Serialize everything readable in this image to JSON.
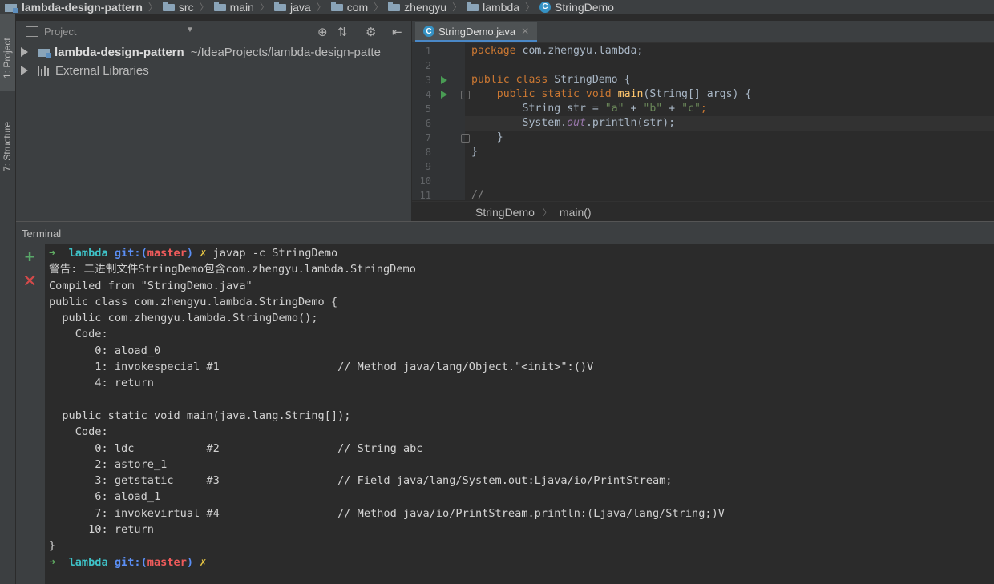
{
  "breadcrumb": [
    "lambda-design-pattern",
    "src",
    "main",
    "java",
    "com",
    "zhengyu",
    "lambda",
    "StringDemo"
  ],
  "class_icon_letter": "C",
  "sidebar": {
    "project_tab": "1: Project",
    "structure_tab": "7: Structure"
  },
  "project_panel": {
    "title": "Project",
    "tree": [
      {
        "name": "lambda-design-pattern",
        "path": "~/IdeaProjects/lambda-design-patte"
      },
      {
        "name": "External Libraries"
      }
    ]
  },
  "editor": {
    "tab": "StringDemo.java",
    "line_numbers": [
      "1",
      "2",
      "3",
      "4",
      "5",
      "6",
      "7",
      "8",
      "9",
      "10",
      "11"
    ],
    "code": {
      "l1_kw": "package",
      "l1_rest": " com.zhengyu.lambda;",
      "l3_kw": "public class",
      "l3_rest": " StringDemo {",
      "l4_kw": "public static void",
      "l4_fn": "main",
      "l4_rest": "(String[] args) {",
      "l5_a": "String str = ",
      "l5_s1": "\"a\"",
      "l5_p1": " + ",
      "l5_s2": "\"b\"",
      "l5_p2": " + ",
      "l5_s3": "\"c\"",
      "l5_end": ";",
      "l6_a": "System.",
      "l6_it": "out",
      "l6_b": ".println(str);",
      "l7": "}",
      "l8": "}",
      "l11": "//"
    },
    "footer_crumb": [
      "StringDemo",
      "main()"
    ]
  },
  "terminal": {
    "title": "Terminal",
    "prompt": {
      "arrow": "➜",
      "dir": "lambda",
      "git": "git:(",
      "branch": "master",
      "git_close": ")",
      "mark": "✗"
    },
    "command": "javap -c StringDemo",
    "output": [
      "警告: 二进制文件StringDemo包含com.zhengyu.lambda.StringDemo",
      "Compiled from \"StringDemo.java\"",
      "public class com.zhengyu.lambda.StringDemo {",
      "  public com.zhengyu.lambda.StringDemo();",
      "    Code:",
      "       0: aload_0",
      "       1: invokespecial #1                  // Method java/lang/Object.\"<init>\":()V",
      "       4: return",
      "",
      "  public static void main(java.lang.String[]);",
      "    Code:",
      "       0: ldc           #2                  // String abc",
      "       2: astore_1",
      "       3: getstatic     #3                  // Field java/lang/System.out:Ljava/io/PrintStream;",
      "       6: aload_1",
      "       7: invokevirtual #4                  // Method java/io/PrintStream.println:(Ljava/lang/String;)V",
      "      10: return",
      "}"
    ],
    "new_session_icon": "+",
    "close_session_icon": "✕"
  },
  "colors": {
    "keyword": "#cc7832",
    "string": "#6a8759",
    "method": "#ffc66d",
    "accent": "#4a88c7"
  }
}
